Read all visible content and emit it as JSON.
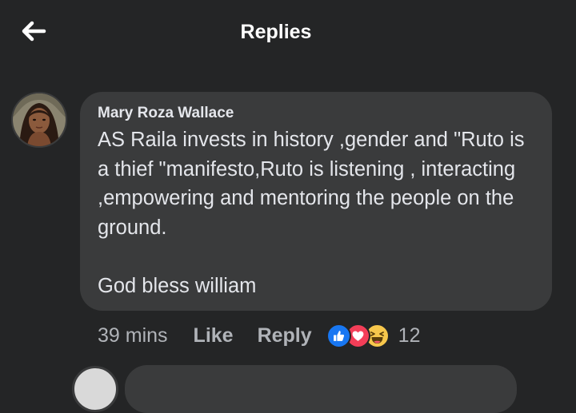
{
  "header": {
    "title": "Replies",
    "back_icon": "arrow-left-icon"
  },
  "comment": {
    "author": "Mary Roza Wallace",
    "text": "AS Raila invests in history ,gender and \"Ruto is a thief \"manifesto,Ruto is listening , interacting ,empowering and mentoring the people on the ground.\n\nGod bless william",
    "time": "39 mins",
    "like_label": "Like",
    "reply_label": "Reply",
    "reactions": [
      "like-reaction-icon",
      "love-reaction-icon",
      "haha-reaction-icon"
    ],
    "reaction_count": "12"
  },
  "colors": {
    "background": "#242526",
    "bubble": "#3a3b3c",
    "text": "#e4e6eb",
    "muted": "#b0b3b8",
    "like_blue": "#1877f2",
    "love_red": "#f33e58",
    "haha_yellow": "#f7c74c"
  }
}
